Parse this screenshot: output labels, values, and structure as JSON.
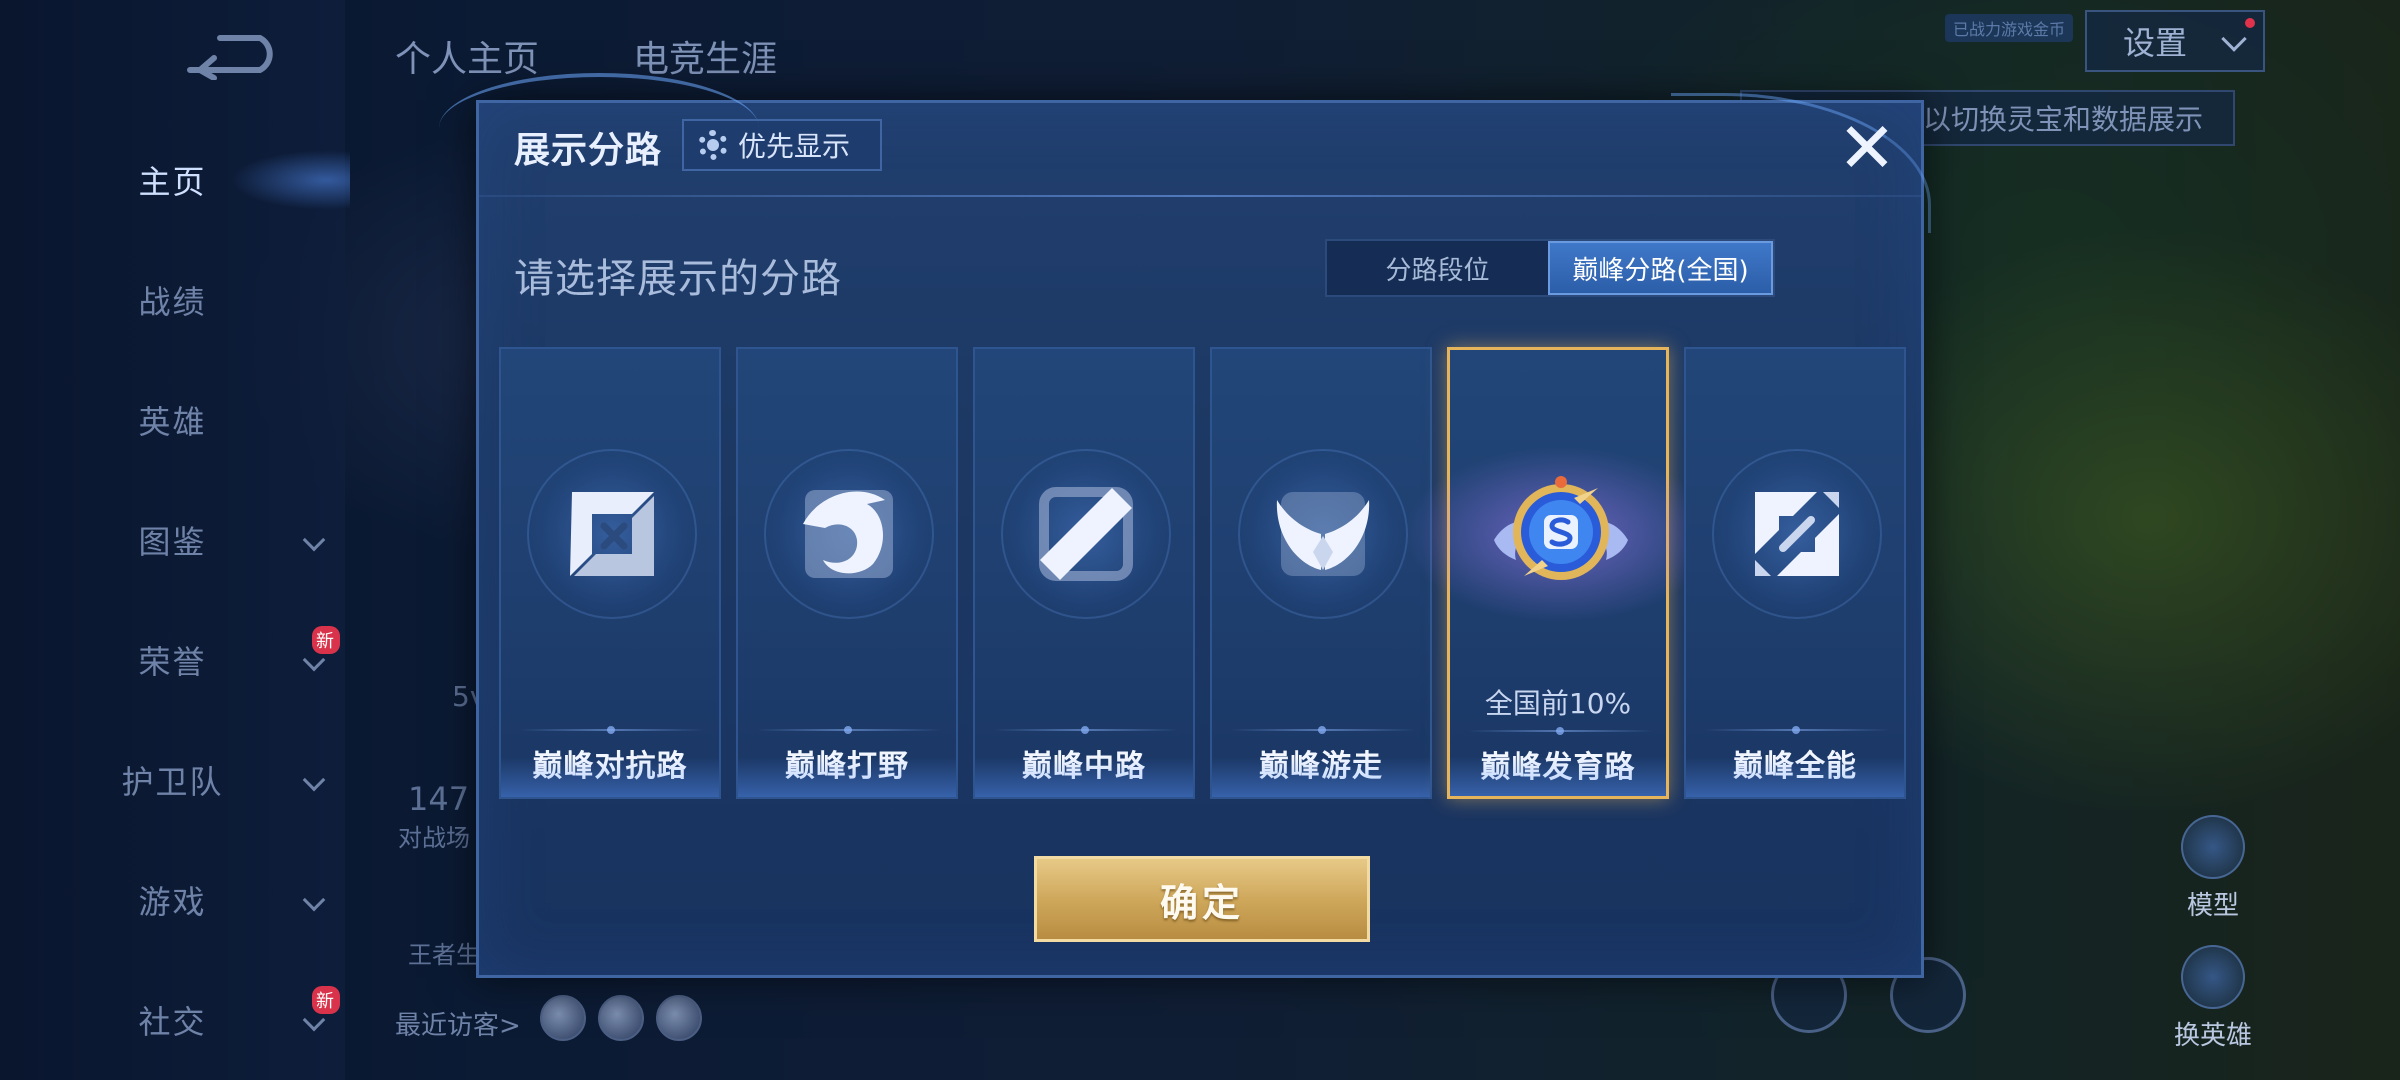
{
  "left_nav": {
    "items": [
      {
        "label": "主页",
        "active": true
      },
      {
        "label": "战绩"
      },
      {
        "label": "英雄"
      },
      {
        "label": "图鉴",
        "has_dropdown": true
      },
      {
        "label": "荣誉",
        "has_dropdown": true,
        "badge": "新"
      },
      {
        "label": "护卫队",
        "has_dropdown": true
      },
      {
        "label": "游戏",
        "has_dropdown": true
      },
      {
        "label": "社交",
        "has_dropdown": true,
        "badge": "新"
      }
    ]
  },
  "top_tabs": {
    "profile": "个人主页",
    "career": "电竞生涯"
  },
  "background": {
    "recent_visitors": "最近访客>",
    "faded_stat": "147",
    "faded_stat_label": "对战场",
    "faded_glory": "王者生",
    "faded_5v": "5v"
  },
  "top_right": {
    "settings": "设置",
    "tag": "已战力游戏金币",
    "hint": "以切换灵宝和数据展示"
  },
  "right_tools": {
    "model": "模型",
    "change_hero": "换英雄"
  },
  "dialog": {
    "title": "展示分路",
    "priority_button": "优先显示",
    "prompt": "请选择展示的分路",
    "tabs": [
      {
        "label": "分路段位",
        "active": false
      },
      {
        "label": "巅峰分路(全国)",
        "active": true
      }
    ],
    "lanes": [
      {
        "label": "巅峰对抗路",
        "icon": "clash-lane-icon"
      },
      {
        "label": "巅峰打野",
        "icon": "jungle-dragon-icon"
      },
      {
        "label": "巅峰中路",
        "icon": "mid-lane-icon"
      },
      {
        "label": "巅峰游走",
        "icon": "roam-wings-icon"
      },
      {
        "label": "巅峰发育路",
        "icon": "farm-lane-rank-emblem-icon",
        "rank": "全国前10%",
        "selected": true
      },
      {
        "label": "巅峰全能",
        "icon": "all-round-icon"
      }
    ],
    "confirm": "确定",
    "colors": {
      "selected_border": "#e6b45a",
      "active_tab": "#3f78c9",
      "confirm_gold": "#cfa85c"
    }
  }
}
